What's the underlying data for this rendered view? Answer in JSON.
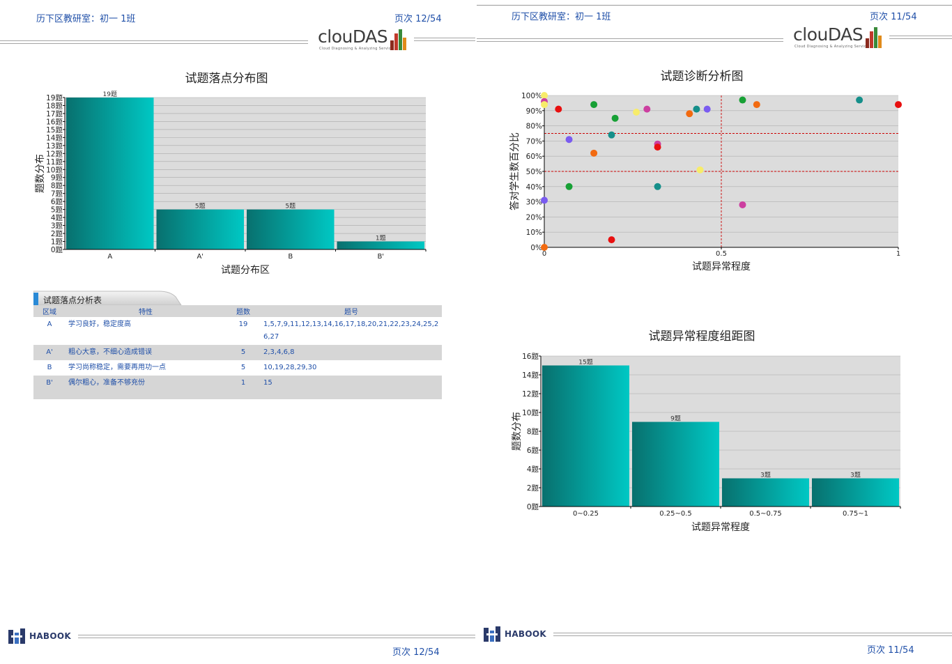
{
  "left": {
    "header_title": "历下区教研室：初一 1班",
    "header_page": "页次 12/54",
    "footer_page": "页次 12/54",
    "brand": {
      "wordmark": "clouDAS",
      "tagline": "Cloud Diagnosing & Analyzing Service",
      "footer": "HABOOK"
    },
    "chart_title": "试题落点分布图",
    "table": {
      "tab_label": "试题落点分析表",
      "headers": [
        "区域",
        "特性",
        "题数",
        "题号"
      ],
      "rows": [
        {
          "zone": "A",
          "desc": "学习良好，稳定度高",
          "count": "19",
          "ids": "1,5,7,9,11,12,13,14,16,17,18,20,21,22,23,24,25,26,27"
        },
        {
          "zone": "A'",
          "desc": "粗心大意，不细心造成错误",
          "count": "5",
          "ids": "2,3,4,6,8"
        },
        {
          "zone": "B",
          "desc": "学习尚称稳定，需要再用功一点",
          "count": "5",
          "ids": "10,19,28,29,30"
        },
        {
          "zone": "B'",
          "desc": "偶尔粗心，准备不够充份",
          "count": "1",
          "ids": "15"
        }
      ]
    }
  },
  "right": {
    "header_title": "历下区教研室：初一 1班",
    "header_page": "页次 11/54",
    "footer_page": "页次 11/54",
    "brand": {
      "wordmark": "clouDAS",
      "tagline": "Cloud Diagnosing & Analyzing Service",
      "footer": "HABOOK"
    },
    "scatter_title": "试题诊断分析图",
    "hist_title": "试题异常程度组距图"
  },
  "colors": {
    "header_text": "#1f4fa8",
    "bar_dark": "#08706e",
    "bar_light": "#00c8c4",
    "plot_bg": "#dcdcdc",
    "ref_line": "#cc0000"
  },
  "chart_data": [
    {
      "type": "bar",
      "title": "试题落点分布图",
      "xlabel": "试题分布区",
      "ylabel": "题数分布",
      "categories": [
        "A",
        "A'",
        "B",
        "B'"
      ],
      "values": [
        19,
        5,
        5,
        1
      ],
      "data_labels": [
        "19题",
        "5题",
        "5题",
        "1题"
      ],
      "ylim": [
        0,
        19
      ],
      "y_unit": "题",
      "grid": true
    },
    {
      "type": "scatter",
      "title": "试题诊断分析图",
      "xlabel": "试题异常程度",
      "ylabel": "答对学生数百分比",
      "xlim": [
        0,
        1
      ],
      "ylim": [
        0,
        100
      ],
      "x_ticks": [
        "0",
        "0.5",
        "1"
      ],
      "y_ticks": [
        "0%",
        "10%",
        "20%",
        "30%",
        "40%",
        "50%",
        "60%",
        "70%",
        "80%",
        "90%",
        "100%"
      ],
      "reference_lines": {
        "x": [
          0.5
        ],
        "y": [
          50,
          75
        ]
      },
      "points": [
        {
          "x": 0.0,
          "y": 100,
          "color": "#f7ec6a"
        },
        {
          "x": 0.0,
          "y": 96,
          "color": "#cc3fa0"
        },
        {
          "x": 0.0,
          "y": 94,
          "color": "#f7ec6a"
        },
        {
          "x": 0.04,
          "y": 91,
          "color": "#e81010"
        },
        {
          "x": 0.07,
          "y": 71,
          "color": "#7a5cf0"
        },
        {
          "x": 0.07,
          "y": 40,
          "color": "#17a035"
        },
        {
          "x": 0.0,
          "y": 31,
          "color": "#7a5cf0"
        },
        {
          "x": 0.0,
          "y": 0,
          "color": "#f26a10"
        },
        {
          "x": 0.14,
          "y": 94,
          "color": "#17a035"
        },
        {
          "x": 0.14,
          "y": 62,
          "color": "#f26a10"
        },
        {
          "x": 0.19,
          "y": 74,
          "color": "#158f8a"
        },
        {
          "x": 0.2,
          "y": 85,
          "color": "#17a035"
        },
        {
          "x": 0.19,
          "y": 5,
          "color": "#e81010"
        },
        {
          "x": 0.26,
          "y": 89,
          "color": "#f7ec6a"
        },
        {
          "x": 0.29,
          "y": 91,
          "color": "#cc3fa0"
        },
        {
          "x": 0.32,
          "y": 68,
          "color": "#cc3fa0"
        },
        {
          "x": 0.32,
          "y": 66,
          "color": "#e81010"
        },
        {
          "x": 0.32,
          "y": 40,
          "color": "#158f8a"
        },
        {
          "x": 0.41,
          "y": 88,
          "color": "#f26a10"
        },
        {
          "x": 0.43,
          "y": 91,
          "color": "#158f8a"
        },
        {
          "x": 0.44,
          "y": 51,
          "color": "#f7ec6a"
        },
        {
          "x": 0.46,
          "y": 91,
          "color": "#7a5cf0"
        },
        {
          "x": 0.56,
          "y": 97,
          "color": "#17a035"
        },
        {
          "x": 0.56,
          "y": 28,
          "color": "#cc3fa0"
        },
        {
          "x": 0.6,
          "y": 94,
          "color": "#f26a10"
        },
        {
          "x": 0.89,
          "y": 97,
          "color": "#158f8a"
        },
        {
          "x": 1.0,
          "y": 94,
          "color": "#e81010"
        }
      ]
    },
    {
      "type": "bar",
      "title": "试题异常程度组距图",
      "xlabel": "试题异常程度",
      "ylabel": "题数分布",
      "categories": [
        "0~0.25",
        "0.25~0.5",
        "0.5~0.75",
        "0.75~1"
      ],
      "values": [
        15,
        9,
        3,
        3
      ],
      "data_labels": [
        "15题",
        "9题",
        "3题",
        "3题"
      ],
      "ylim": [
        0,
        16
      ],
      "y_ticks": [
        0,
        2,
        4,
        6,
        8,
        10,
        12,
        14,
        16
      ],
      "y_unit": "题",
      "grid": true
    }
  ]
}
